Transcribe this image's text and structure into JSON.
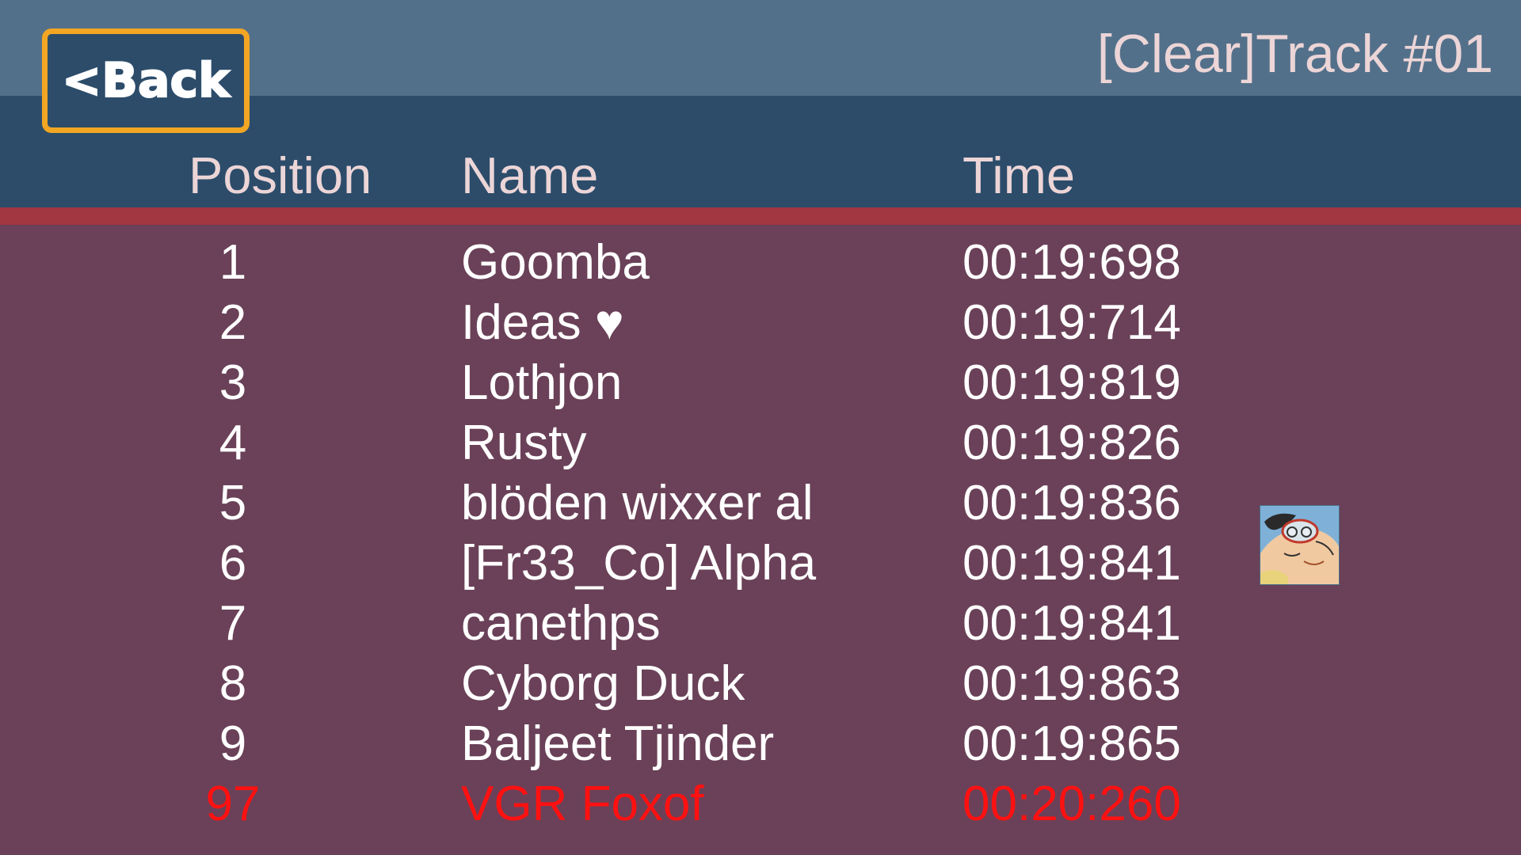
{
  "header": {
    "back_label": "<Back",
    "track_title": "[Clear]Track #01"
  },
  "columns": {
    "position": "Position",
    "name": "Name",
    "time": "Time"
  },
  "leaderboard": [
    {
      "position": "1",
      "name": "Goomba",
      "time": "00:19:698"
    },
    {
      "position": "2",
      "name": "Ideas ♥",
      "time": "00:19:714"
    },
    {
      "position": "3",
      "name": "Lothjon",
      "time": "00:19:819"
    },
    {
      "position": "4",
      "name": "Rusty",
      "time": "00:19:826"
    },
    {
      "position": "5",
      "name": "blöden wixxer al",
      "time": "00:19:836"
    },
    {
      "position": "6",
      "name": "[Fr33_Co] Alpha",
      "time": "00:19:841"
    },
    {
      "position": "7",
      "name": "canethps",
      "time": "00:19:841"
    },
    {
      "position": "8",
      "name": "Cyborg Duck",
      "time": "00:19:863"
    },
    {
      "position": "9",
      "name": "Baljeet Tjinder",
      "time": "00:19:865"
    }
  ],
  "player_entry": {
    "position": "97",
    "name": "VGR Foxof",
    "time": "00:20:260"
  },
  "colors": {
    "top_band": "#53708a",
    "header_band": "#2c4c6a",
    "stripe": "#a23641",
    "background": "#6a4158",
    "back_border": "#f2a623",
    "player_highlight": "#ff1111"
  },
  "avatar": {
    "icon": "cartoon-avatar-icon"
  }
}
